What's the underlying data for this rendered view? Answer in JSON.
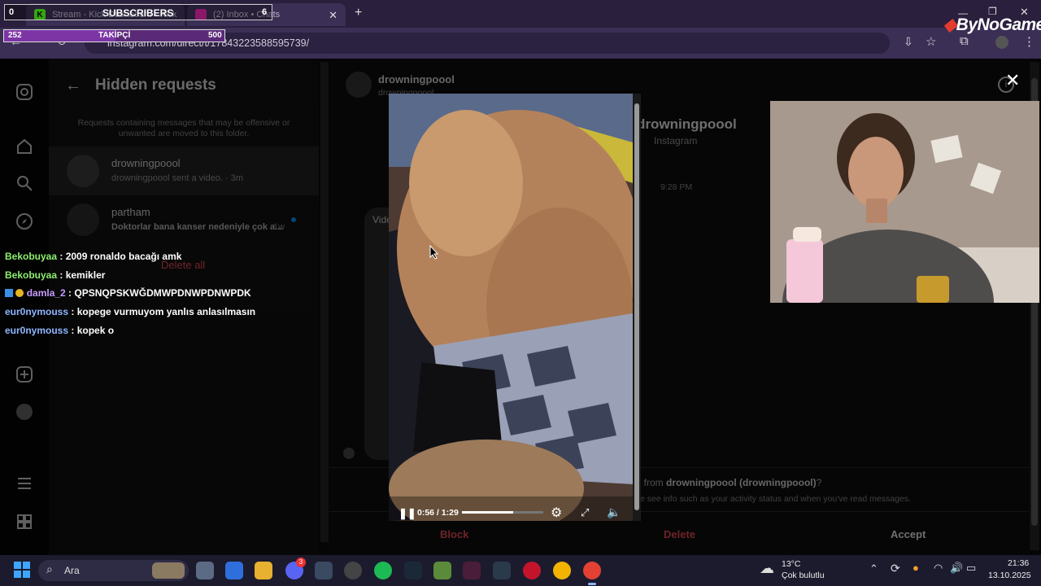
{
  "browser": {
    "tabs": [
      {
        "title": "Stream - Kick Dashboard - Kick"
      },
      {
        "title": "(2) Inbox • Chats"
      }
    ],
    "new_tab_label": "+",
    "url": "instagram.com/direct/t/17843223588595739/"
  },
  "overlay": {
    "subscribers": {
      "label": "SUBSCRIBERS",
      "current": "0",
      "goal": "6"
    },
    "followers": {
      "label": "TAKİPÇİ",
      "current": "252",
      "goal": "500",
      "progress": 0.504
    },
    "brand": "ByNoGame"
  },
  "requests_panel": {
    "title": "Hidden requests",
    "description": "Requests containing messages that may be offensive or unwanted are moved to this folder.",
    "items": [
      {
        "name": "drowningpoool",
        "preview": "drowningpoool sent a video. · 3m"
      },
      {
        "name": "partham",
        "preview": "Doktorlar bana kanser nedeniyle çok a...",
        "time": "1w"
      }
    ],
    "delete_all": "Delete all"
  },
  "chat_panel": {
    "header_name": "drowningpoool",
    "header_sub": "drowningpoool",
    "profile_name": "drowningpoool",
    "profile_sub": "Instagram",
    "timestamp": "9:28 PM",
    "video_label": "Vide",
    "request_prefix": "t from",
    "request_name": "drowningpoool (drowningpoool)",
    "request_suffix": "?",
    "request_note": "e see info such as your activity status and when you've read messages.",
    "actions": {
      "block": "Block",
      "delete": "Delete",
      "accept": "Accept"
    }
  },
  "stream_chat": [
    {
      "user": "Bekobuyaa",
      "msg": "2009 ronaldo bacağı amk",
      "color": "#8cf06e"
    },
    {
      "user": "Bekobuyaa",
      "msg": "kemikler",
      "color": "#8cf06e"
    },
    {
      "user": "damla_2",
      "msg": "QPSNQPSKWĞDMWPDNWPDNWPDK",
      "color": "#c79cff"
    },
    {
      "user": "eur0nymouss",
      "msg": "kopege vurmuyom yanlıs anlasılmasın",
      "color": "#8fb6ff"
    },
    {
      "user": "eur0nymouss",
      "msg": "kopek o",
      "color": "#8fb6ff"
    }
  ],
  "video_player": {
    "time": "0:56 / 1:29",
    "progress": 0.63
  },
  "taskbar": {
    "search_label": "Ara",
    "weather_temp": "13°C",
    "weather_desc": "Çok bulutlu",
    "time": "21:36",
    "date": "13.10.2025",
    "discord_badge": "3"
  }
}
